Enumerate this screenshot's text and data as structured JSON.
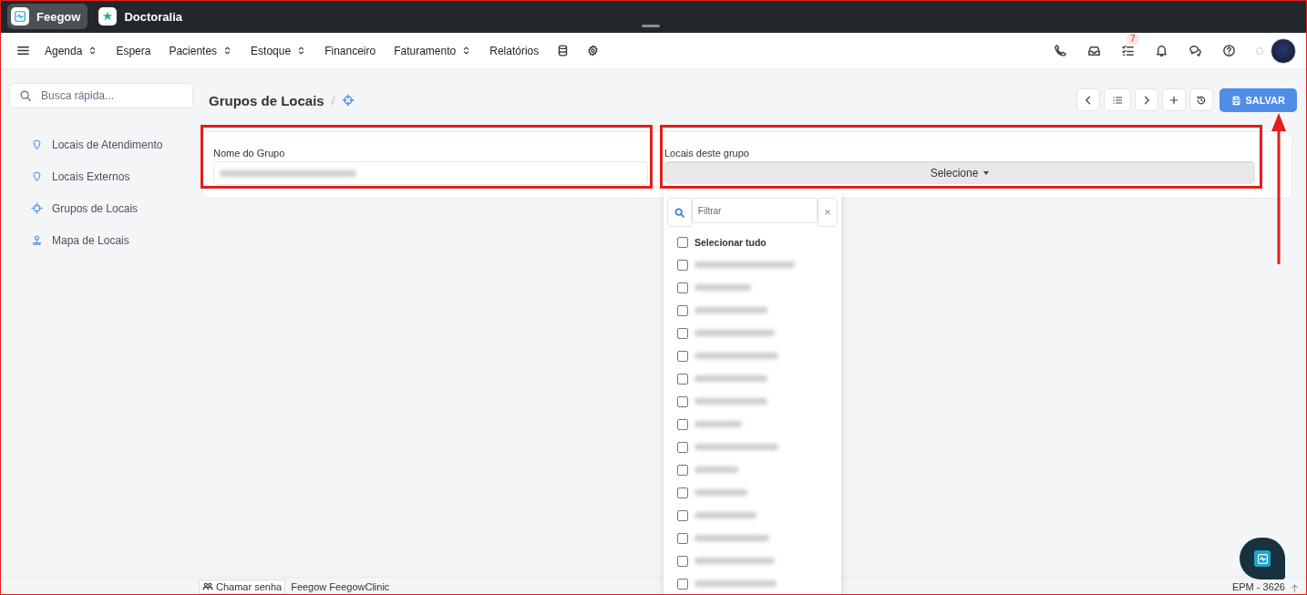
{
  "apps": [
    {
      "label": "Feegow",
      "selected": true
    },
    {
      "label": "Doctoralia",
      "selected": false
    }
  ],
  "nav": [
    {
      "label": "Agenda",
      "dropdown": true
    },
    {
      "label": "Espera",
      "dropdown": false
    },
    {
      "label": "Pacientes",
      "dropdown": true
    },
    {
      "label": "Estoque",
      "dropdown": true
    },
    {
      "label": "Financeiro",
      "dropdown": false
    },
    {
      "label": "Faturamento",
      "dropdown": true
    },
    {
      "label": "Relatórios",
      "dropdown": false
    }
  ],
  "tasks_badge": "7",
  "search": {
    "placeholder": "Busca rápida..."
  },
  "sidebar": {
    "items": [
      {
        "label": "Locais de Atendimento",
        "kind": "pin"
      },
      {
        "label": "Locais Externos",
        "kind": "pin"
      },
      {
        "label": "Grupos de Locais",
        "kind": "target"
      },
      {
        "label": "Mapa de Locais",
        "kind": "map"
      }
    ]
  },
  "page": {
    "title": "Grupos de Locais",
    "separator": "/"
  },
  "toolbar": {
    "save_label": "SALVAR"
  },
  "form": {
    "name_label": "Nome do Grupo",
    "locations_label": "Locais deste grupo",
    "select_label": "Selecione"
  },
  "dropdown": {
    "filter_placeholder": "Filtrar",
    "select_all": {
      "label": "Selecionar tudo",
      "checked": false
    },
    "options": [
      {
        "checked": false
      },
      {
        "checked": false
      },
      {
        "checked": false
      },
      {
        "checked": false
      },
      {
        "checked": false
      },
      {
        "checked": false
      },
      {
        "checked": false
      },
      {
        "checked": false
      },
      {
        "checked": false
      },
      {
        "checked": false
      },
      {
        "checked": false
      },
      {
        "checked": false
      },
      {
        "checked": false
      },
      {
        "checked": false
      },
      {
        "checked": false
      }
    ]
  },
  "footer": {
    "call_button": "Chamar senha",
    "org": "Feegow FeegowClinic",
    "version": "EPM - 3626"
  }
}
